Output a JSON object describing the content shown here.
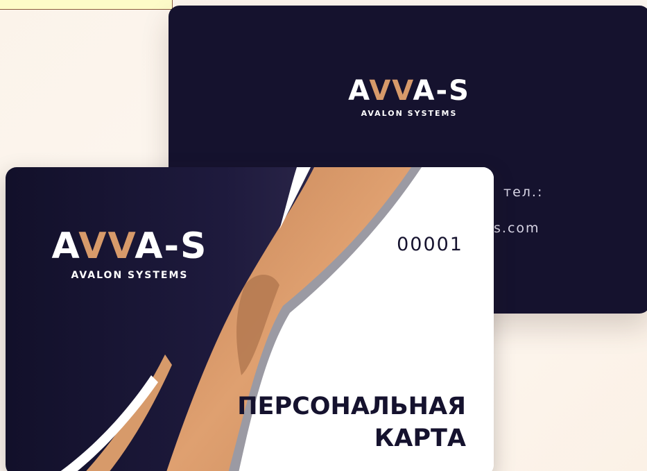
{
  "brand": {
    "wordmark_start": "A",
    "wordmark_accent": "VV",
    "wordmark_end": "A-S",
    "subtitle": "AVALON SYSTEMS"
  },
  "back_card": {
    "phone_label_fragment": "тел.:",
    "email_fragment": "s.com"
  },
  "front_card": {
    "number": "00001",
    "title_line1": "ПЕРСОНАЛЬНАЯ",
    "title_line2": "КАРТА"
  },
  "colors": {
    "card_navy": "#15122e",
    "accent_copper": "#d79a6a",
    "accent_gray": "#9b9aa3",
    "background": "#fbf3ea"
  }
}
